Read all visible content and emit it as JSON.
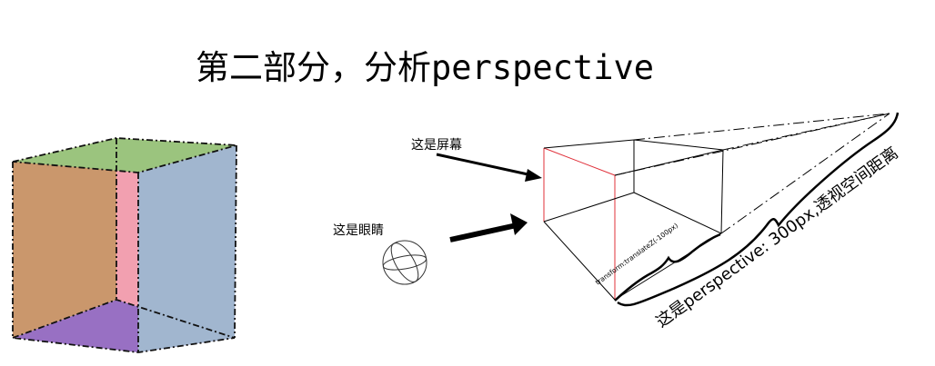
{
  "title": "第二部分，分析perspective",
  "labels": {
    "screen": "这是屏幕",
    "eye": "这是眼睛",
    "translate": "transform:translateZ(-100px)",
    "distance": "这是perspective: 300px,透视空间距离"
  },
  "colors": {
    "cube_top": "#9bc47e",
    "cube_left": "#c89366",
    "cube_right": "#a1b6cf",
    "cube_back": "#f2a0b0",
    "cube_bottom": "#9870c3",
    "screen_edge": "#e0303a"
  }
}
